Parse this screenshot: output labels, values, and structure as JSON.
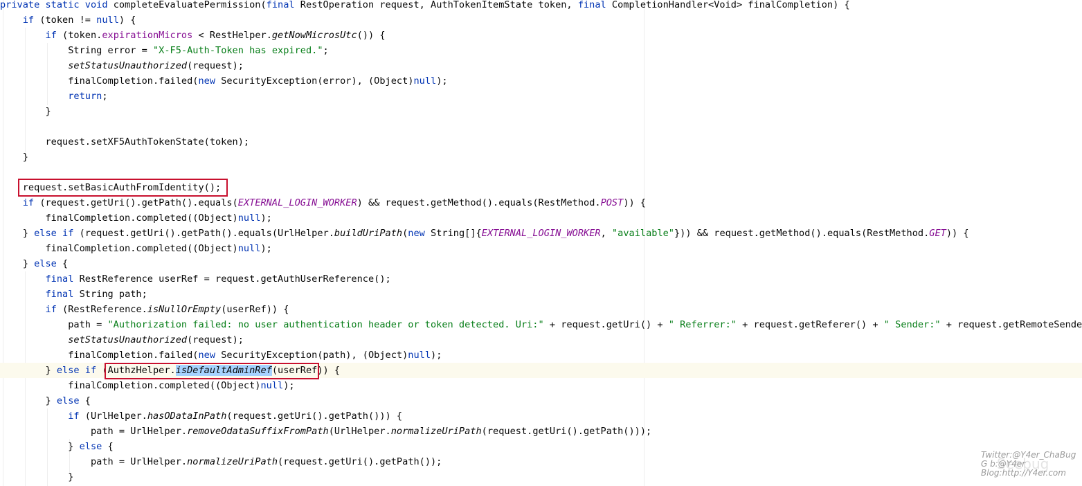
{
  "code_lines": [
    {
      "tokens": [
        [
          "private static void ",
          "kw"
        ],
        [
          "completeEvaluatePermission",
          ""
        ],
        [
          "(",
          ""
        ],
        [
          "final ",
          "kw"
        ],
        [
          "RestOperation request, AuthTokenItemState token, ",
          ""
        ],
        [
          "final ",
          "kw"
        ],
        [
          "CompletionHandler<Void> finalCompletion) {",
          ""
        ]
      ]
    },
    {
      "tokens": [
        [
          "    ",
          ""
        ],
        [
          "if ",
          "kw"
        ],
        [
          "(token != ",
          ""
        ],
        [
          "null",
          "kw"
        ],
        [
          ") {",
          ""
        ]
      ]
    },
    {
      "tokens": [
        [
          "        ",
          ""
        ],
        [
          "if ",
          "kw"
        ],
        [
          "(token.",
          ""
        ],
        [
          "expirationMicros",
          "fld"
        ],
        [
          " < RestHelper.",
          ""
        ],
        [
          "getNowMicrosUtc",
          "sm"
        ],
        [
          "()) {",
          ""
        ]
      ]
    },
    {
      "tokens": [
        [
          "            String error = ",
          ""
        ],
        [
          "\"X-F5-Auth-Token has expired.\"",
          "str"
        ],
        [
          ";",
          ""
        ]
      ]
    },
    {
      "tokens": [
        [
          "            ",
          ""
        ],
        [
          "setStatusUnauthorized",
          "sm"
        ],
        [
          "(request);",
          ""
        ]
      ]
    },
    {
      "tokens": [
        [
          "            finalCompletion.failed(",
          ""
        ],
        [
          "new ",
          "kw"
        ],
        [
          "SecurityException(error), (Object)",
          ""
        ],
        [
          "null",
          "kw"
        ],
        [
          ");",
          ""
        ]
      ]
    },
    {
      "tokens": [
        [
          "            ",
          ""
        ],
        [
          "return",
          "kw"
        ],
        [
          ";",
          ""
        ]
      ]
    },
    {
      "tokens": [
        [
          "        }",
          ""
        ]
      ]
    },
    {
      "tokens": []
    },
    {
      "tokens": [
        [
          "        request.setXF5AuthTokenState(token);",
          ""
        ]
      ]
    },
    {
      "tokens": [
        [
          "    }",
          ""
        ]
      ]
    },
    {
      "tokens": []
    },
    {
      "tokens": [
        [
          "    request.setBasicAuthFromIdentity();",
          ""
        ]
      ]
    },
    {
      "tokens": [
        [
          "    ",
          ""
        ],
        [
          "if ",
          "kw"
        ],
        [
          "(request.getUri().getPath().equals(",
          ""
        ],
        [
          "EXTERNAL_LOGIN_WORKER",
          "cst"
        ],
        [
          ") && request.getMethod().equals(RestMethod.",
          ""
        ],
        [
          "POST",
          "cst"
        ],
        [
          ")) {",
          ""
        ]
      ]
    },
    {
      "tokens": [
        [
          "        finalCompletion.completed((Object)",
          ""
        ],
        [
          "null",
          "kw"
        ],
        [
          ");",
          ""
        ]
      ]
    },
    {
      "tokens": [
        [
          "    } ",
          ""
        ],
        [
          "else if ",
          "kw"
        ],
        [
          "(request.getUri().getPath().equals(UrlHelper.",
          ""
        ],
        [
          "buildUriPath",
          "sm"
        ],
        [
          "(",
          ""
        ],
        [
          "new ",
          "kw"
        ],
        [
          "String[]{",
          ""
        ],
        [
          "EXTERNAL_LOGIN_WORKER",
          "cst"
        ],
        [
          ", ",
          ""
        ],
        [
          "\"available\"",
          "str"
        ],
        [
          "})) && request.getMethod().equals(RestMethod.",
          ""
        ],
        [
          "GET",
          "cst"
        ],
        [
          ")) {",
          ""
        ]
      ]
    },
    {
      "tokens": [
        [
          "        finalCompletion.completed((Object)",
          ""
        ],
        [
          "null",
          "kw"
        ],
        [
          ");",
          ""
        ]
      ]
    },
    {
      "tokens": [
        [
          "    } ",
          ""
        ],
        [
          "else ",
          "kw"
        ],
        [
          "{",
          ""
        ]
      ]
    },
    {
      "tokens": [
        [
          "        ",
          ""
        ],
        [
          "final ",
          "kw"
        ],
        [
          "RestReference userRef = request.getAuthUserReference();",
          ""
        ]
      ]
    },
    {
      "tokens": [
        [
          "        ",
          ""
        ],
        [
          "final ",
          "kw"
        ],
        [
          "String path;",
          ""
        ]
      ]
    },
    {
      "tokens": [
        [
          "        ",
          ""
        ],
        [
          "if ",
          "kw"
        ],
        [
          "(RestReference.",
          ""
        ],
        [
          "isNullOrEmpty",
          "sm"
        ],
        [
          "(userRef)) {",
          ""
        ]
      ]
    },
    {
      "tokens": [
        [
          "            path = ",
          ""
        ],
        [
          "\"Authorization failed: no user authentication header or token detected. Uri:\"",
          "str"
        ],
        [
          " + request.getUri() + ",
          ""
        ],
        [
          "\" Referrer:\"",
          "str"
        ],
        [
          " + request.getReferer() + ",
          ""
        ],
        [
          "\" Sender:\"",
          "str"
        ],
        [
          " + request.getRemoteSender();",
          ""
        ]
      ]
    },
    {
      "tokens": [
        [
          "            ",
          ""
        ],
        [
          "setStatusUnauthorized",
          "sm"
        ],
        [
          "(request);",
          ""
        ]
      ]
    },
    {
      "tokens": [
        [
          "            finalCompletion.failed(",
          ""
        ],
        [
          "new ",
          "kw"
        ],
        [
          "SecurityException(path), (Object)",
          ""
        ],
        [
          "null",
          "kw"
        ],
        [
          ");",
          ""
        ]
      ]
    },
    {
      "tokens": [
        [
          "        } ",
          ""
        ],
        [
          "else if ",
          "kw"
        ],
        [
          "(AuthzHelper.",
          ""
        ],
        [
          "isDefaultAdminRef",
          "sm sel"
        ],
        [
          "(userRef)) {",
          ""
        ]
      ],
      "current": true
    },
    {
      "tokens": [
        [
          "            finalCompletion.completed((Object)",
          ""
        ],
        [
          "null",
          "kw"
        ],
        [
          ");",
          ""
        ]
      ]
    },
    {
      "tokens": [
        [
          "        } ",
          ""
        ],
        [
          "else ",
          "kw"
        ],
        [
          "{",
          ""
        ]
      ]
    },
    {
      "tokens": [
        [
          "            ",
          ""
        ],
        [
          "if ",
          "kw"
        ],
        [
          "(UrlHelper.",
          ""
        ],
        [
          "hasODataInPath",
          "sm"
        ],
        [
          "(request.getUri().getPath())) {",
          ""
        ]
      ]
    },
    {
      "tokens": [
        [
          "                path = UrlHelper.",
          ""
        ],
        [
          "removeOdataSuffixFromPath",
          "sm"
        ],
        [
          "(UrlHelper.",
          ""
        ],
        [
          "normalizeUriPath",
          "sm"
        ],
        [
          "(request.getUri().getPath()));",
          ""
        ]
      ]
    },
    {
      "tokens": [
        [
          "            } ",
          ""
        ],
        [
          "else ",
          "kw"
        ],
        [
          "{",
          ""
        ]
      ]
    },
    {
      "tokens": [
        [
          "                path = UrlHelper.",
          ""
        ],
        [
          "normalizeUriPath",
          "sm"
        ],
        [
          "(request.getUri().getPath());",
          ""
        ]
      ]
    },
    {
      "tokens": [
        [
          "            }",
          ""
        ]
      ]
    }
  ],
  "watermark": {
    "line1": "Twitter:@Y4er_ChaBug",
    "line2": "G          b:@Y4er",
    "line3": "Blog:http://Y4er.com",
    "ghost": "Seebug"
  },
  "colors": {
    "keyword": "#0033b3",
    "string": "#067d17",
    "field": "#871094",
    "highlight_box": "#c8102e",
    "selection": "#a6d2ff",
    "current_line": "#fcfaed"
  }
}
